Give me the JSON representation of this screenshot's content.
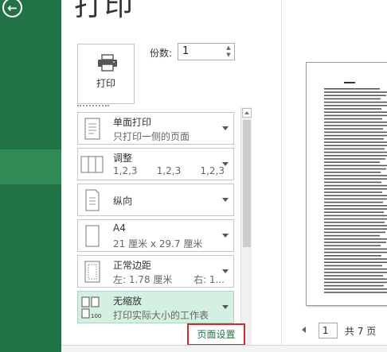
{
  "nav": {
    "back_icon": "back-arrow-icon",
    "back_glyph": "←"
  },
  "page": {
    "heading": "打印"
  },
  "print_button": {
    "label": "打印",
    "icon": "printer-icon"
  },
  "copies": {
    "label": "份数:",
    "value": "1"
  },
  "options": [
    {
      "title": "单面打印",
      "subtitle": "只打印一侧的页面",
      "icon": "single-page-icon"
    },
    {
      "title": "调整",
      "subtitle_parts": [
        "1,2,3",
        "1,2,3",
        "1,2,3"
      ],
      "icon": "collate-icon"
    },
    {
      "title": "纵向",
      "subtitle": "",
      "icon": "portrait-icon"
    },
    {
      "title": "A4",
      "subtitle": "21 厘米 x 29.7 厘米",
      "icon": "paper-size-icon"
    },
    {
      "title": "正常边距",
      "subtitle_left": "左: 1.78 厘米",
      "subtitle_right": "右: 1...",
      "icon": "margins-icon"
    },
    {
      "title": "无缩放",
      "subtitle": "打印实际大小的工作表",
      "icon": "no-scaling-icon",
      "selected": true
    }
  ],
  "page_setup": {
    "label": "页面设置"
  },
  "pager": {
    "current": "1",
    "total": "共 7 页"
  },
  "colors": {
    "accent": "#217346",
    "highlight_border": "#d9262a",
    "selected_bg": "#d3f0e0"
  }
}
